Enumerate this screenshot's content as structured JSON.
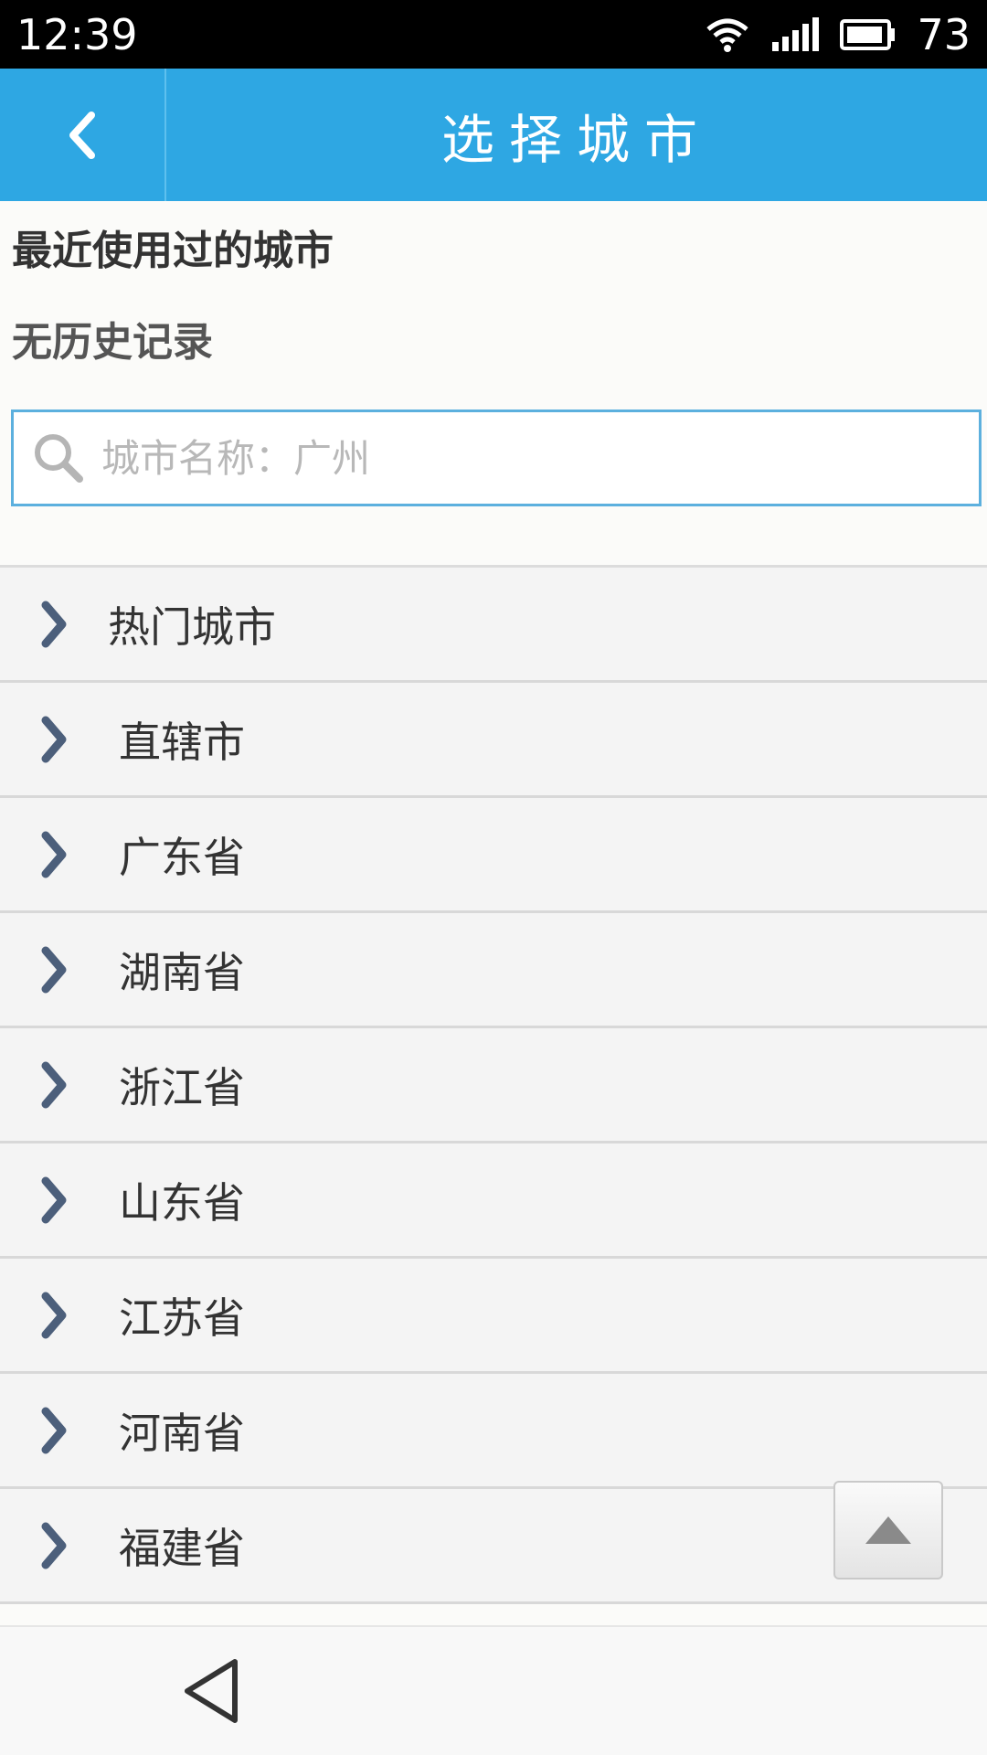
{
  "status_bar": {
    "time": "12:39",
    "battery": "73",
    "icons": [
      "wifi-icon",
      "signal-icon",
      "battery-icon"
    ]
  },
  "header": {
    "title": "选择城市",
    "back_icon": "chevron-left-icon",
    "color": "#2ea7e3"
  },
  "recent": {
    "title": "最近使用过的城市",
    "empty_text": "无历史记录"
  },
  "search": {
    "placeholder": "城市名称：广州",
    "value": ""
  },
  "regions": [
    {
      "label": "热门城市"
    },
    {
      "label": "直辖市"
    },
    {
      "label": "广东省"
    },
    {
      "label": "湖南省"
    },
    {
      "label": "浙江省"
    },
    {
      "label": "山东省"
    },
    {
      "label": "江苏省"
    },
    {
      "label": "河南省"
    },
    {
      "label": "福建省"
    }
  ],
  "scroll_top_icon": "triangle-up-icon",
  "nav": {
    "back_icon": "triangle-back-icon"
  }
}
